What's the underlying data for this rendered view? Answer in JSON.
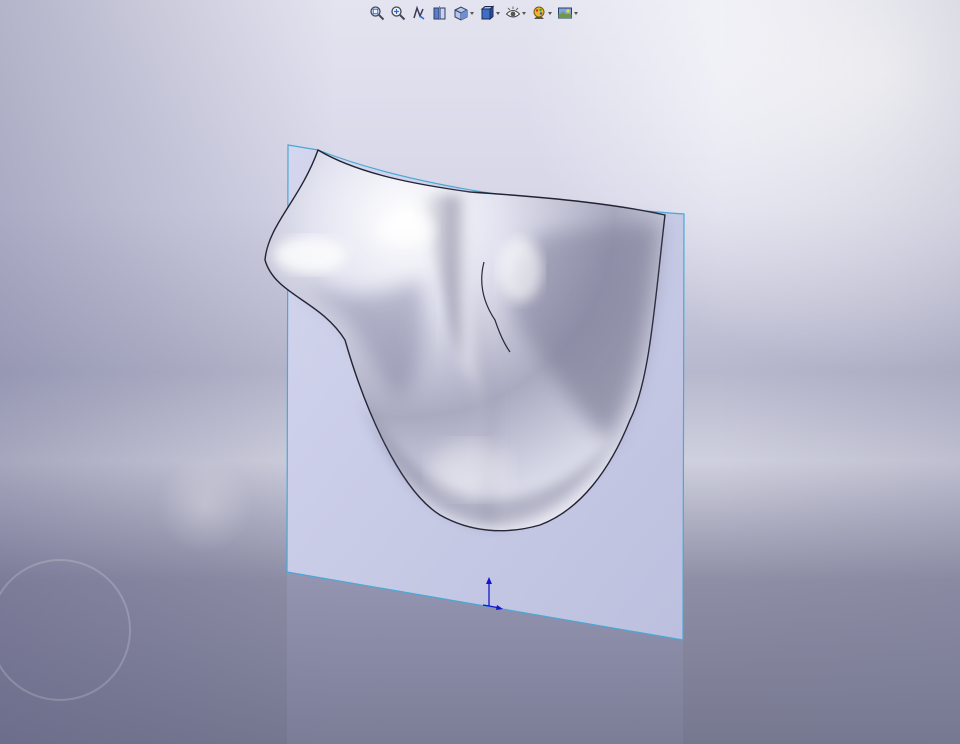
{
  "app": {
    "view": "graphics-area"
  },
  "toolbar": {
    "buttons": [
      {
        "name": "zoom-to-fit",
        "icon": "zoom-to-fit-icon",
        "has_dropdown": false
      },
      {
        "name": "zoom-to-area",
        "icon": "zoom-to-area-icon",
        "has_dropdown": false
      },
      {
        "name": "previous-view",
        "icon": "previous-view-icon",
        "has_dropdown": false
      },
      {
        "name": "section-view",
        "icon": "section-view-icon",
        "has_dropdown": false
      },
      {
        "name": "view-orientation",
        "icon": "view-orientation-icon",
        "has_dropdown": true
      },
      {
        "name": "display-style",
        "icon": "display-style-icon",
        "has_dropdown": true
      },
      {
        "name": "hide-show-items",
        "icon": "hide-show-items-icon",
        "has_dropdown": true
      },
      {
        "name": "edit-appearance",
        "icon": "edit-appearance-icon",
        "has_dropdown": true
      },
      {
        "name": "apply-scene",
        "icon": "apply-scene-icon",
        "has_dropdown": true
      }
    ]
  },
  "colors": {
    "plane_fill": "#c6c9e4",
    "plane_edge": "#48a8d6",
    "surface_light": "#ffffff",
    "surface_mid": "#b9bace",
    "surface_dark": "#6f6f88",
    "triad_blue": "#1515d0"
  }
}
